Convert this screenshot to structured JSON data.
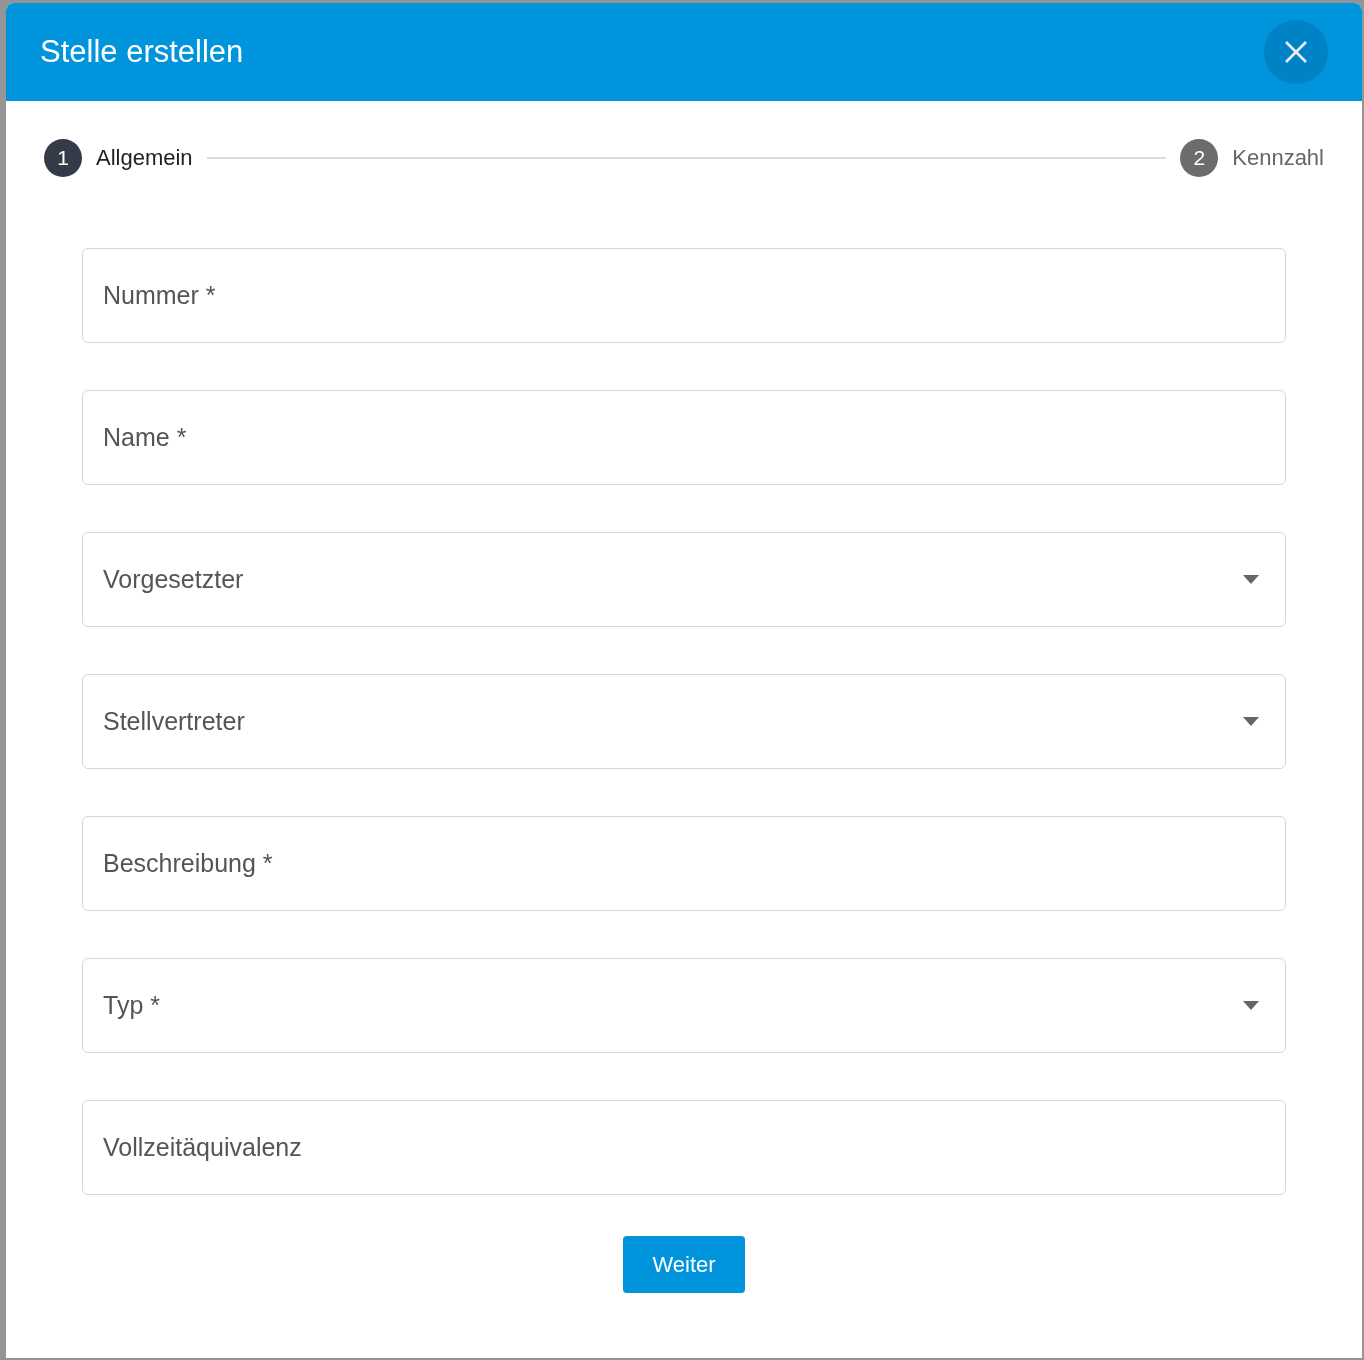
{
  "dialog": {
    "title": "Stelle erstellen"
  },
  "steps": [
    {
      "number": "1",
      "label": "Allgemein",
      "selected": true
    },
    {
      "number": "2",
      "label": "Kennzahl",
      "selected": false
    }
  ],
  "fields": [
    {
      "kind": "text",
      "placeholder": "Nummer *"
    },
    {
      "kind": "text",
      "placeholder": "Name *"
    },
    {
      "kind": "select",
      "placeholder": "Vorgesetzter"
    },
    {
      "kind": "select",
      "placeholder": "Stellvertreter"
    },
    {
      "kind": "text",
      "placeholder": "Beschreibung *"
    },
    {
      "kind": "select",
      "placeholder": "Typ *"
    },
    {
      "kind": "text",
      "placeholder": "Vollzeitäquivalenz"
    }
  ],
  "button": {
    "label": "Weiter"
  }
}
